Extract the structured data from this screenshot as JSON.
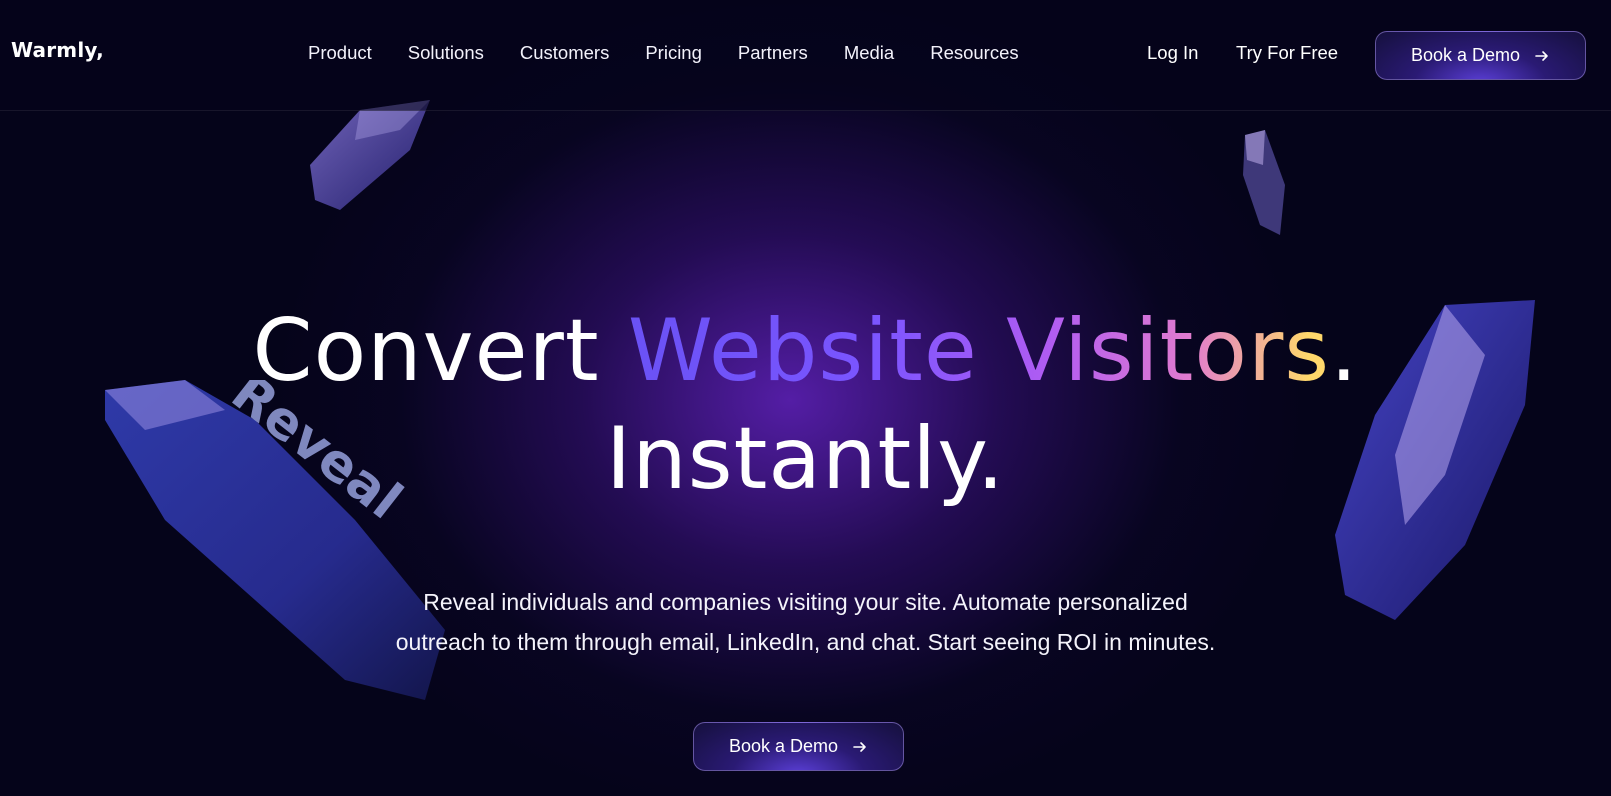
{
  "header": {
    "logo": "Warmly,",
    "nav": [
      "Product",
      "Solutions",
      "Customers",
      "Pricing",
      "Partners",
      "Media",
      "Resources"
    ],
    "login": "Log In",
    "try_free": "Try For Free",
    "book_demo": "Book a Demo"
  },
  "hero": {
    "title_convert": "Convert",
    "title_highlight": "Website Visitors",
    "title_period": ".",
    "title_line2": "Instantly.",
    "subtitle_line1": "Reveal individuals and companies visiting your site. Automate personalized",
    "subtitle_line2": "outreach to them through email, LinkedIn, and chat. Start seeing ROI in minutes.",
    "cta": "Book a Demo",
    "crystal_text": "Reveal"
  },
  "colors": {
    "background": "#05041a",
    "glow": "#6222be",
    "accent": "#6a52f5",
    "gradient_end": "#ffd86b"
  },
  "icons": {
    "arrow": "arrow-right-icon"
  }
}
